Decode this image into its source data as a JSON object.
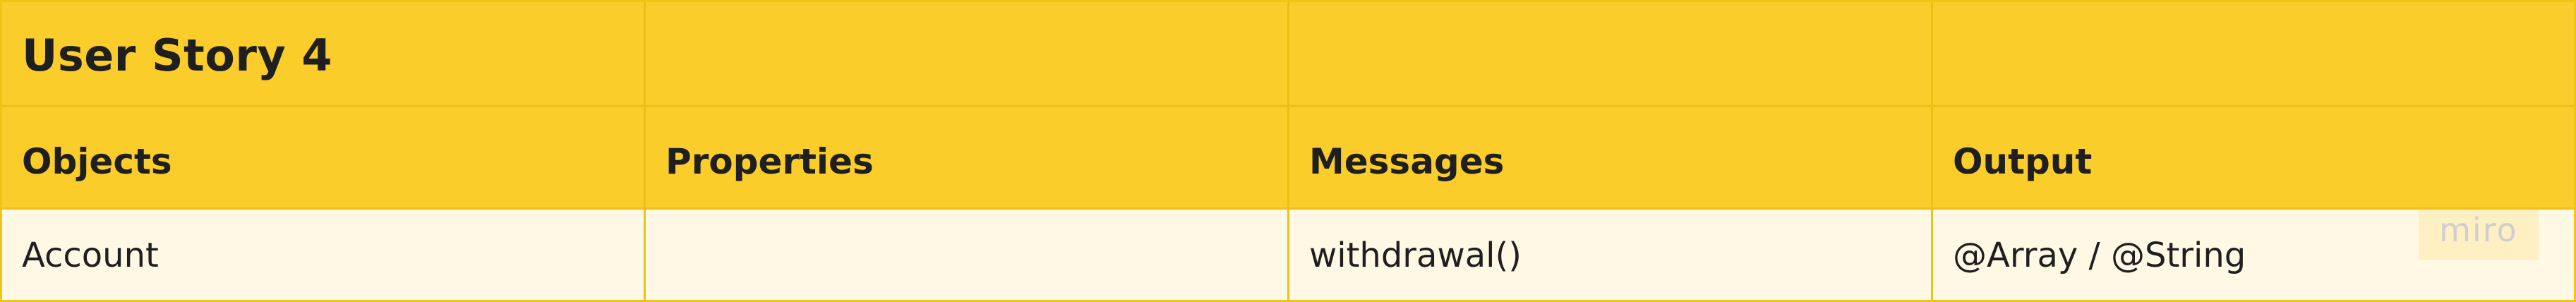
{
  "board": {
    "title": "User Story 4",
    "columns": [
      "Objects",
      "Properties",
      "Messages",
      "Output"
    ],
    "rows": [
      [
        "Account",
        "",
        "withdrawal()",
        "@Array / @String"
      ]
    ],
    "watermark": "miro",
    "colors": {
      "header_bg": "#fbcd2a",
      "body_bg": "#fff8e5",
      "border": "#eebf15",
      "text": "#1f1f1f"
    }
  }
}
